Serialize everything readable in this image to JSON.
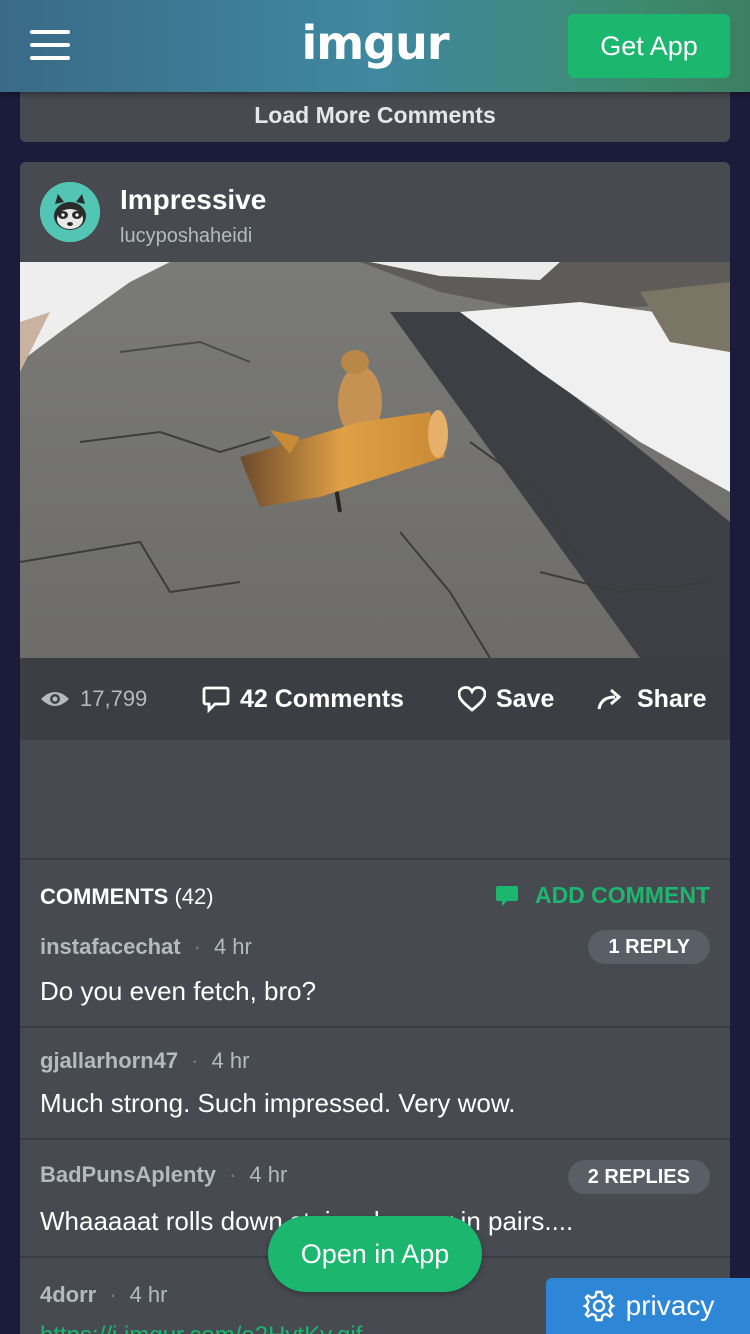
{
  "header": {
    "logo": "imgur",
    "get_app_label": "Get App"
  },
  "load_more_label": "Load More Comments",
  "post": {
    "title": "Impressive",
    "username": "lucyposhaheidi",
    "views": "17,799",
    "comments_label": "42 Comments",
    "save_label": "Save",
    "share_label": "Share"
  },
  "comments_section": {
    "title": "COMMENTS",
    "count": "(42)",
    "add_label": "ADD COMMENT"
  },
  "comments": [
    {
      "user": "instafacechat",
      "time": "4 hr",
      "text": "Do you even fetch, bro?",
      "replies": "1 REPLY"
    },
    {
      "user": "gjallarhorn47",
      "time": "4 hr",
      "text": "Much strong. Such impressed. Very wow."
    },
    {
      "user": "BadPunsAplenty",
      "time": "4 hr",
      "text": "Whaaaaat rolls down stairs alone or in pairs....",
      "replies": "2 REPLIES"
    },
    {
      "user": "4dorr",
      "time": "4 hr",
      "link": "https://i.imgur.com/e2HvtKy.gif"
    }
  ],
  "open_app_label": "Open in App",
  "privacy_label": "privacy",
  "colors": {
    "accent_green": "#1bb76e",
    "card_bg": "#474a51",
    "page_bg": "#1b1c3b",
    "privacy_blue": "#2e86d6"
  }
}
